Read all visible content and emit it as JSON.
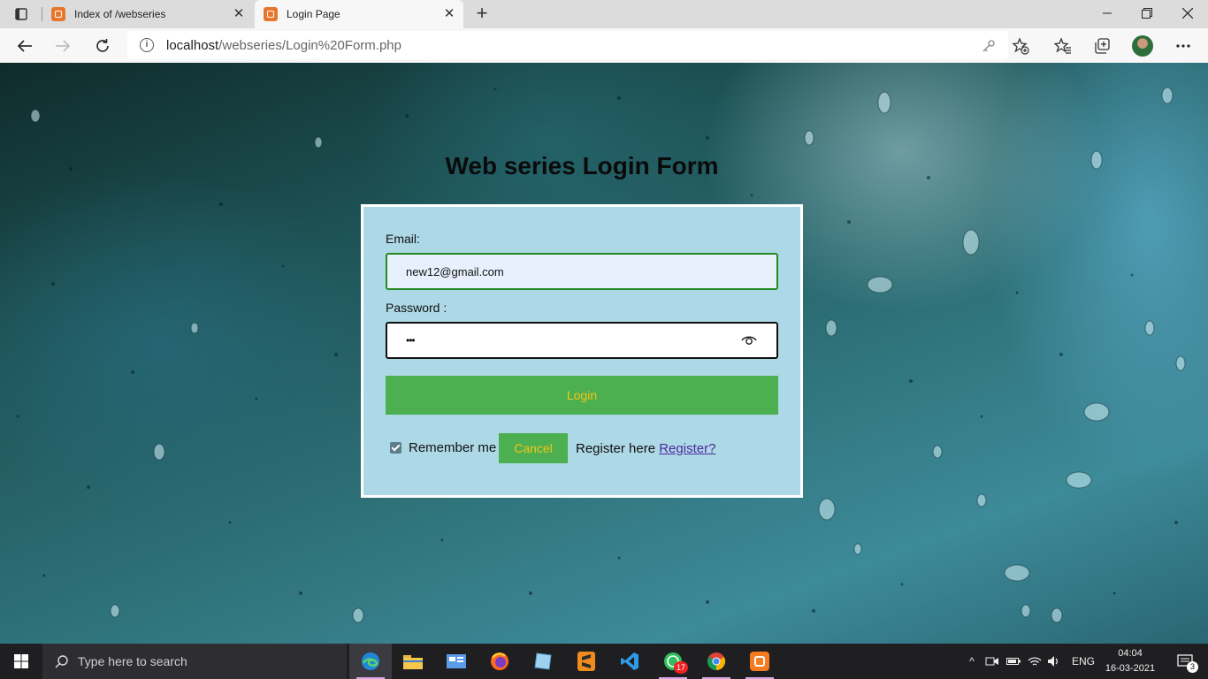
{
  "browser": {
    "tabs": [
      {
        "title": "Index of /webseries"
      },
      {
        "title": "Login Page"
      }
    ],
    "address": {
      "host": "localhost",
      "path": "/webseries/Login%20Form.php"
    }
  },
  "page": {
    "heading": "Web series Login Form",
    "form": {
      "email_label": "Email:",
      "email_value": "new12@gmail.com",
      "password_label": "Password :",
      "password_masked": "•••",
      "login_button": "Login",
      "remember_label": "Remember me",
      "remember_checked": true,
      "cancel_button": "Cancel",
      "register_text": "Register here",
      "register_link": "Register?"
    }
  },
  "taskbar": {
    "search_placeholder": "Type here to search",
    "whatsapp_badge": "17",
    "language": "ENG",
    "time": "04:04",
    "date": "16-03-2021",
    "notifications": "3"
  },
  "colors": {
    "form_bg": "#add8e6",
    "button_green": "#4caf50",
    "button_text": "#f5c518",
    "email_border": "#228b22"
  }
}
